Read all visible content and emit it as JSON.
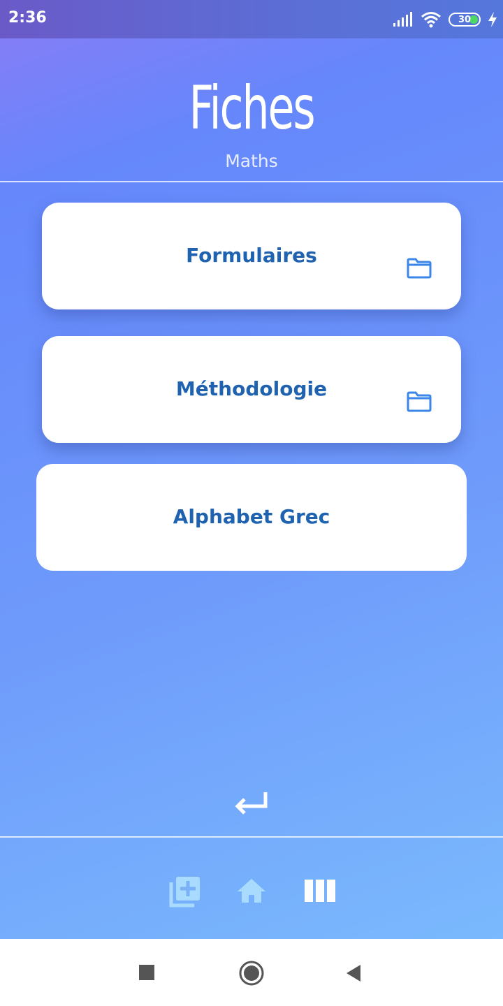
{
  "status_bar": {
    "time": "2:36",
    "battery": "30",
    "icons": [
      "signal-icon",
      "wifi-icon",
      "battery-icon",
      "charging-icon"
    ]
  },
  "header": {
    "title": "Fiches",
    "subtitle": "Maths"
  },
  "cards": [
    {
      "label": "Formulaires",
      "icon": "folder-icon"
    },
    {
      "label": "Méthodologie",
      "icon": "folder-icon"
    },
    {
      "label": "Alphabet Grec"
    }
  ],
  "actions": {
    "back_icon": "return-arrow-icon"
  },
  "bottom_nav": {
    "items": [
      "add-card-icon",
      "home-icon",
      "columns-icon"
    ]
  },
  "system_nav": {
    "items": [
      "recents-square-icon",
      "home-circle-icon",
      "back-triangle-icon"
    ]
  },
  "colors": {
    "card_text": "#1f63b0",
    "folder_icon": "#3b86e8",
    "gradient_top": "#6587fb",
    "gradient_bottom": "#7ab9fd"
  }
}
